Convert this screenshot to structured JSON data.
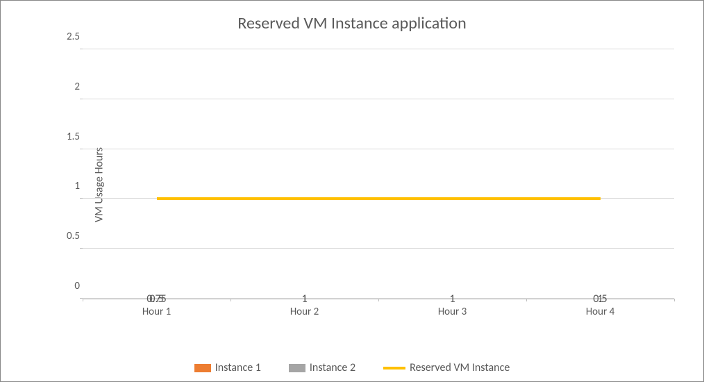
{
  "chart_data": {
    "type": "bar",
    "title": "Reserved VM Instance application",
    "xlabel": "",
    "ylabel": "VM Usage Hours",
    "categories": [
      "Hour 1",
      "Hour 2",
      "Hour 3",
      "Hour 4"
    ],
    "series": [
      {
        "name": "Instance 1",
        "values": [
          0.75,
          1,
          1,
          0.5
        ],
        "color": "#ed7d31"
      },
      {
        "name": "Instance 2",
        "values": [
          0.5,
          1,
          1,
          1
        ],
        "color": "#a5a5a5"
      },
      {
        "name": "Reserved VM Instance",
        "type": "line",
        "values": [
          1,
          1,
          1,
          1
        ],
        "color": "#ffc000"
      }
    ],
    "ylim": [
      0,
      2.5
    ],
    "y_ticks": [
      0,
      0.5,
      1,
      1.5,
      2,
      2.5
    ],
    "stacked": true
  },
  "legend_labels": {
    "s0": "Instance 1",
    "s1": "Instance 2",
    "s2": "Reserved VM Instance"
  },
  "tick_labels": {
    "y0": "0",
    "y1": "0.5",
    "y2": "1",
    "y3": "1.5",
    "y4": "2",
    "y5": "2.5",
    "x0": "Hour 1",
    "x1": "Hour 2",
    "x2": "Hour 3",
    "x3": "Hour 4"
  },
  "data_labels": {
    "b0s0": "0.75",
    "b0s1": "0.5",
    "b1s0": "1",
    "b1s1": "1",
    "b2s0": "1",
    "b2s1": "1",
    "b3s0": "0.5",
    "b3s1": "1"
  }
}
